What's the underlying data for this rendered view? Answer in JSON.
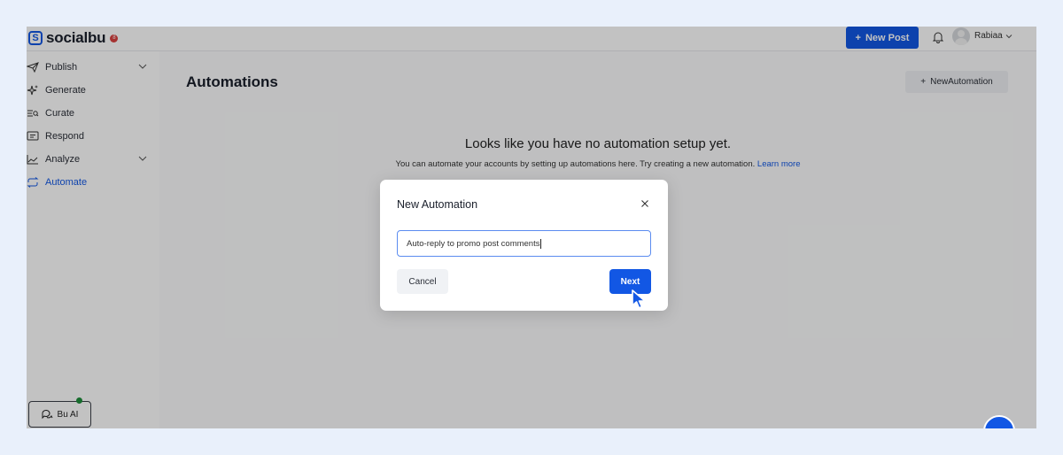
{
  "app": {
    "logo_text": "socialbu",
    "logo_badge": "8"
  },
  "topbar": {
    "new_post_label": "New Post",
    "user_name": "Rabiaa",
    "icons": [
      "bell-icon",
      "avatar",
      "chevron-down-icon"
    ]
  },
  "sidebar": {
    "items": [
      {
        "label": "Publish",
        "icon": "send-icon",
        "has_chevron": true
      },
      {
        "label": "Generate",
        "icon": "sparkle-icon",
        "has_chevron": false
      },
      {
        "label": "Curate",
        "icon": "curate-icon",
        "has_chevron": false
      },
      {
        "label": "Respond",
        "icon": "message-icon",
        "has_chevron": false
      },
      {
        "label": "Analyze",
        "icon": "chart-icon",
        "has_chevron": true
      },
      {
        "label": "Automate",
        "icon": "repeat-icon",
        "has_chevron": false,
        "active": true
      }
    ],
    "bu_ai_label": "Bu AI"
  },
  "main": {
    "title": "Automations",
    "new_automation_label": "NewAutomation",
    "empty_heading": "Looks like you have no automation setup yet.",
    "empty_text": "You can automate your accounts by setting up automations here. Try creating a new automation.",
    "learn_more": "Learn more"
  },
  "modal": {
    "title": "New Automation",
    "input_value": "Auto-reply to promo post comments",
    "cancel_label": "Cancel",
    "next_label": "Next"
  },
  "colors": {
    "accent": "#1257e4",
    "page_bg": "#e9f0fb",
    "online_dot": "#1e8f3b"
  }
}
